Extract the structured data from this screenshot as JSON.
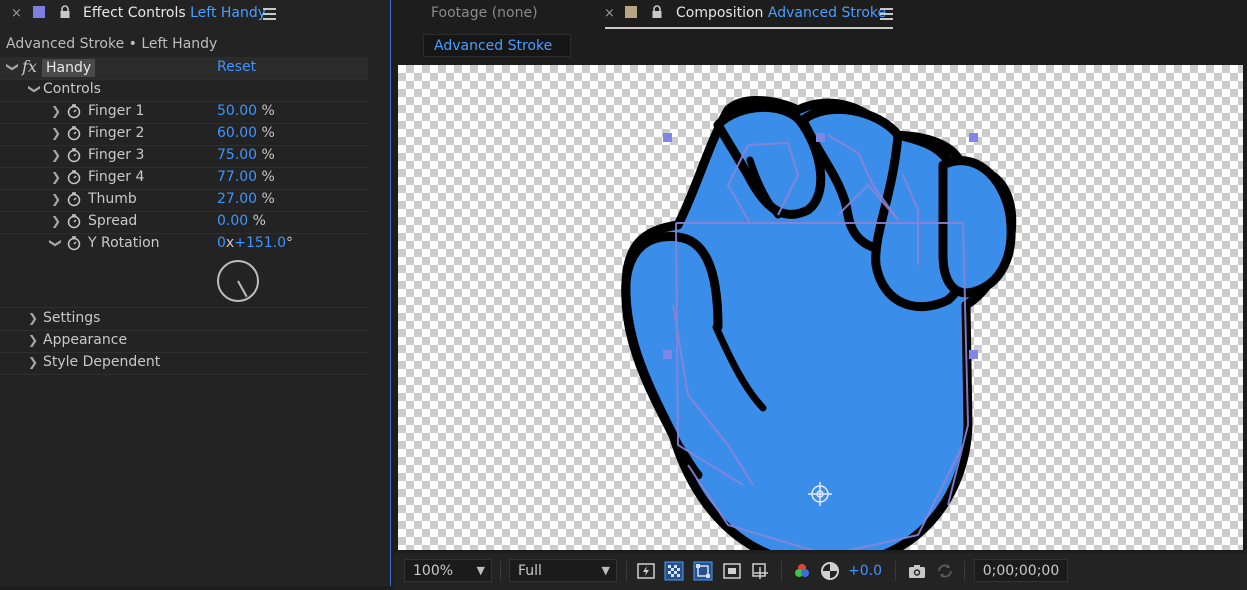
{
  "effect_panel": {
    "close_glyph": "×",
    "tab_prefix": "Effect Controls",
    "tab_layer": "Left Handy",
    "subtitle": "Advanced Stroke • Left Handy",
    "effect_name": "Handy",
    "reset_label": "Reset",
    "fx_glyph": "fx",
    "controls_label": "Controls",
    "properties": [
      {
        "label": "Finger 1",
        "value": "50.00",
        "unit": "%"
      },
      {
        "label": "Finger 2",
        "value": "60.00",
        "unit": "%"
      },
      {
        "label": "Finger 3",
        "value": "75.00",
        "unit": "%"
      },
      {
        "label": "Finger 4",
        "value": "77.00",
        "unit": "%"
      },
      {
        "label": "Thumb",
        "value": "27.00",
        "unit": "%"
      },
      {
        "label": "Spread",
        "value": "0.00",
        "unit": "%"
      }
    ],
    "rotation": {
      "label": "Y Rotation",
      "revolutions": "0",
      "x_glyph": "x",
      "degrees": "+151.0",
      "unit": "°"
    },
    "groups": [
      "Settings",
      "Appearance",
      "Style Dependent"
    ],
    "label_color": "#3a6fd8"
  },
  "viewer_tabs": {
    "footage_tab": "Footage (none)",
    "close_glyph": "×",
    "comp_prefix": "Composition",
    "comp_name": "Advanced Stroke",
    "comp_subtab": "Advanced Stroke",
    "comp_label_color": "#b8a382"
  },
  "viewer": {
    "hand_fill": "#3a8eea",
    "stroke_color": "#000000",
    "handle_color": "#7f86e6",
    "rotation_dial_value_deg": 151
  },
  "bottom_bar": {
    "zoom": "100%",
    "resolution": "Full",
    "exposure": "+0.0",
    "timecode": "0;00;00;00"
  },
  "icons": [
    "close-icon",
    "lock-icon",
    "menu-icon",
    "chevron-icon",
    "stopwatch-icon",
    "fast-preview-icon",
    "transparency-grid-icon",
    "mask-path-icon",
    "region-of-interest-icon",
    "target-region-icon",
    "channel-icon",
    "exposure-reset-icon",
    "snapshot-icon",
    "show-snapshot-icon",
    "anchor-point-icon"
  ]
}
